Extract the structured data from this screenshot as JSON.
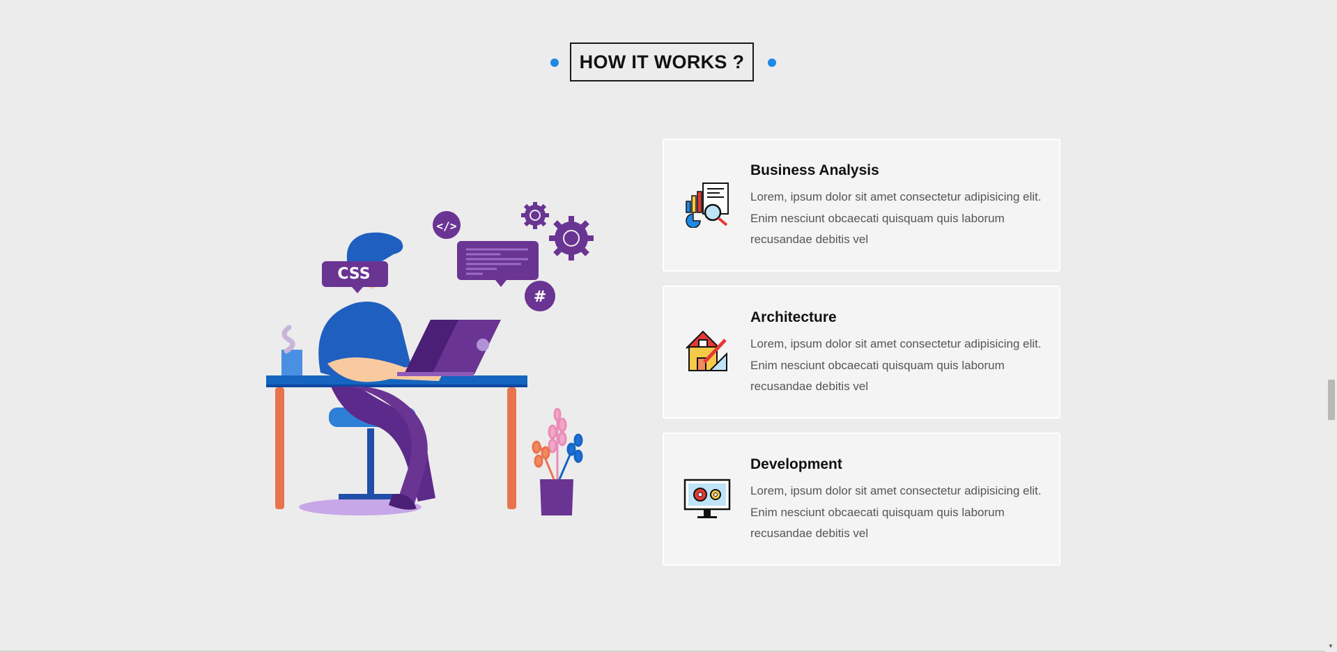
{
  "section": {
    "heading": "HOW IT WORKS ?"
  },
  "illustration": {
    "css_badge": "CSS",
    "code_symbol": "</>",
    "hash_symbol": "#"
  },
  "steps": [
    {
      "title": "Business Analysis",
      "description": "Lorem, ipsum dolor sit amet consectetur adipisicing elit. Enim nesciunt obcaecati quisquam quis laborum recusandae debitis vel",
      "icon": "business-analysis-icon"
    },
    {
      "title": "Architecture",
      "description": "Lorem, ipsum dolor sit amet consectetur adipisicing elit. Enim nesciunt obcaecati quisquam quis laborum recusandae debitis vel",
      "icon": "architecture-icon"
    },
    {
      "title": "Development",
      "description": "Lorem, ipsum dolor sit amet consectetur adipisicing elit. Enim nesciunt obcaecati quisquam quis laborum recusandae debitis vel",
      "icon": "development-icon"
    }
  ],
  "colors": {
    "accent_dot": "#1e88e5",
    "background": "#ececec",
    "card_background": "#f4f4f4",
    "illustration_purple": "#6a3493",
    "illustration_blue": "#1f5fbf"
  }
}
